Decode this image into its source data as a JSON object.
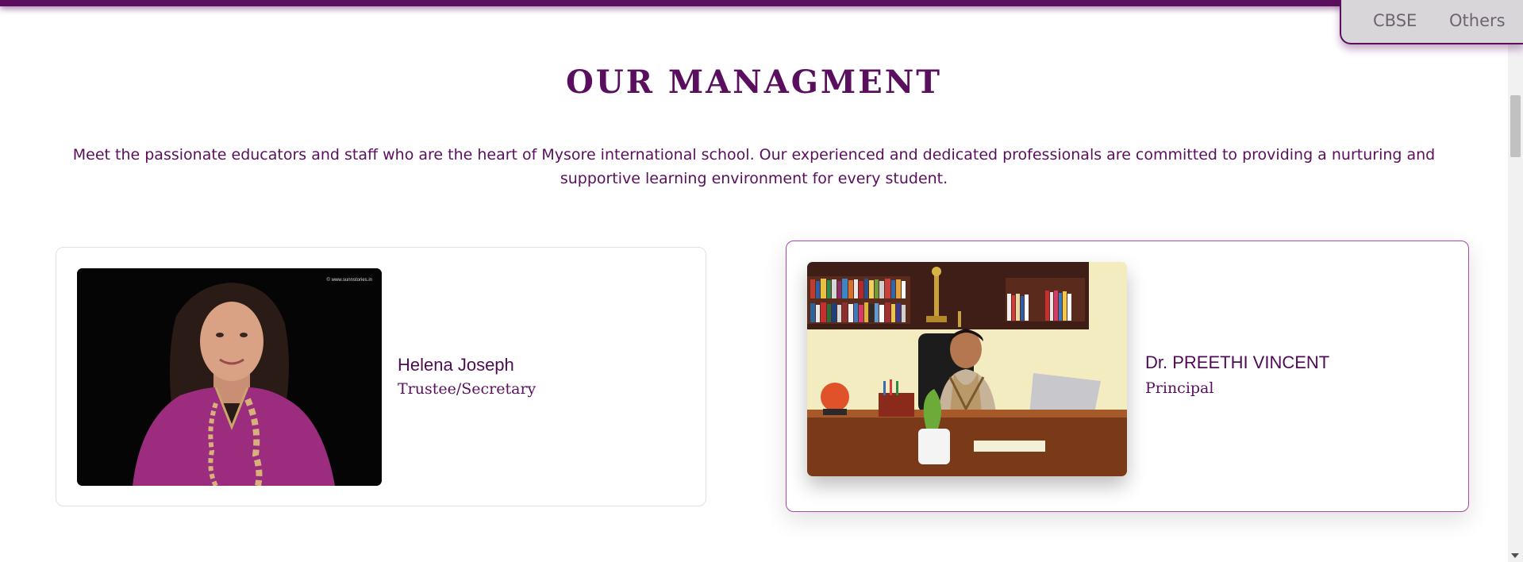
{
  "nav": {
    "items": [
      {
        "label": "CBSE"
      },
      {
        "label": "Others"
      }
    ]
  },
  "section": {
    "title": "OUR MANAGMENT",
    "intro": "Meet the passionate educators and staff who are the heart of Mysore international school. Our experienced and dedicated professionals are committed to providing a nurturing and supportive learning environment for every student."
  },
  "management": [
    {
      "name": "Helena Joseph",
      "role": "Trustee/Secretary",
      "photo_watermark": "© www.sunnstories.in"
    },
    {
      "name": "Dr. PREETHI VINCENT",
      "role": "Principal"
    }
  ],
  "colors": {
    "brand": "#5a0f5e",
    "card_border_highlight": "#a64aa6",
    "nav_bg": "#d9d6da"
  }
}
